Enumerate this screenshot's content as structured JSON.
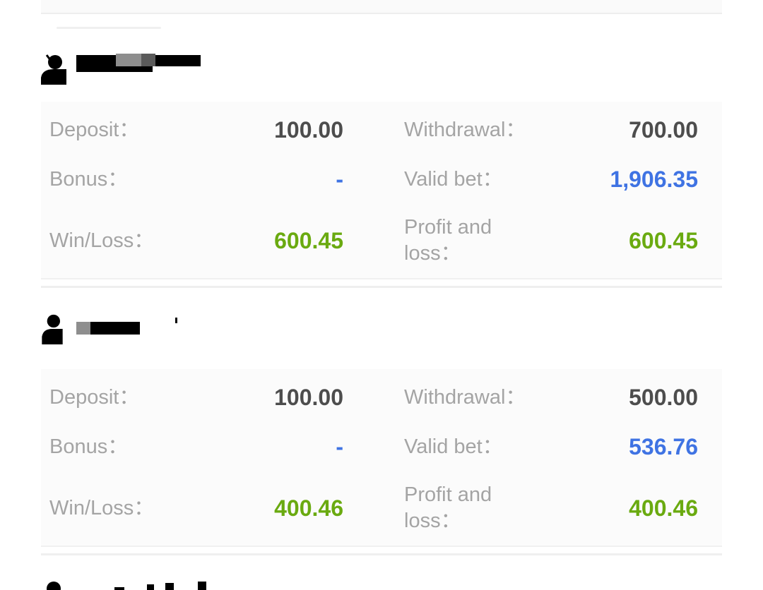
{
  "accounts": [
    {
      "deposit_label": "Deposit：",
      "deposit": "100.00",
      "withdrawal_label": "Withdrawal：",
      "withdrawal": "700.00",
      "bonus_label": "Bonus：",
      "bonus": "-",
      "valid_bet_label": "Valid bet：",
      "valid_bet": "1,906.35",
      "win_loss_label": "Win/Loss：",
      "win_loss": "600.45",
      "profit_label_line1": "Profit and",
      "profit_label_line2": "loss：",
      "profit_and_loss": "600.45"
    },
    {
      "deposit_label": "Deposit：",
      "deposit": "100.00",
      "withdrawal_label": "Withdrawal：",
      "withdrawal": "500.00",
      "bonus_label": "Bonus：",
      "bonus": "-",
      "valid_bet_label": "Valid bet：",
      "valid_bet": "536.76",
      "win_loss_label": "Win/Loss：",
      "win_loss": "400.46",
      "profit_label_line1": "Profit and",
      "profit_label_line2": "loss：",
      "profit_and_loss": "400.46"
    }
  ],
  "colors": {
    "label": "#a4a4a4",
    "value_dark": "#4d4d4d",
    "value_blue": "#3f73e3",
    "value_green": "#6aaa10"
  },
  "icons": [
    "user-icon"
  ]
}
